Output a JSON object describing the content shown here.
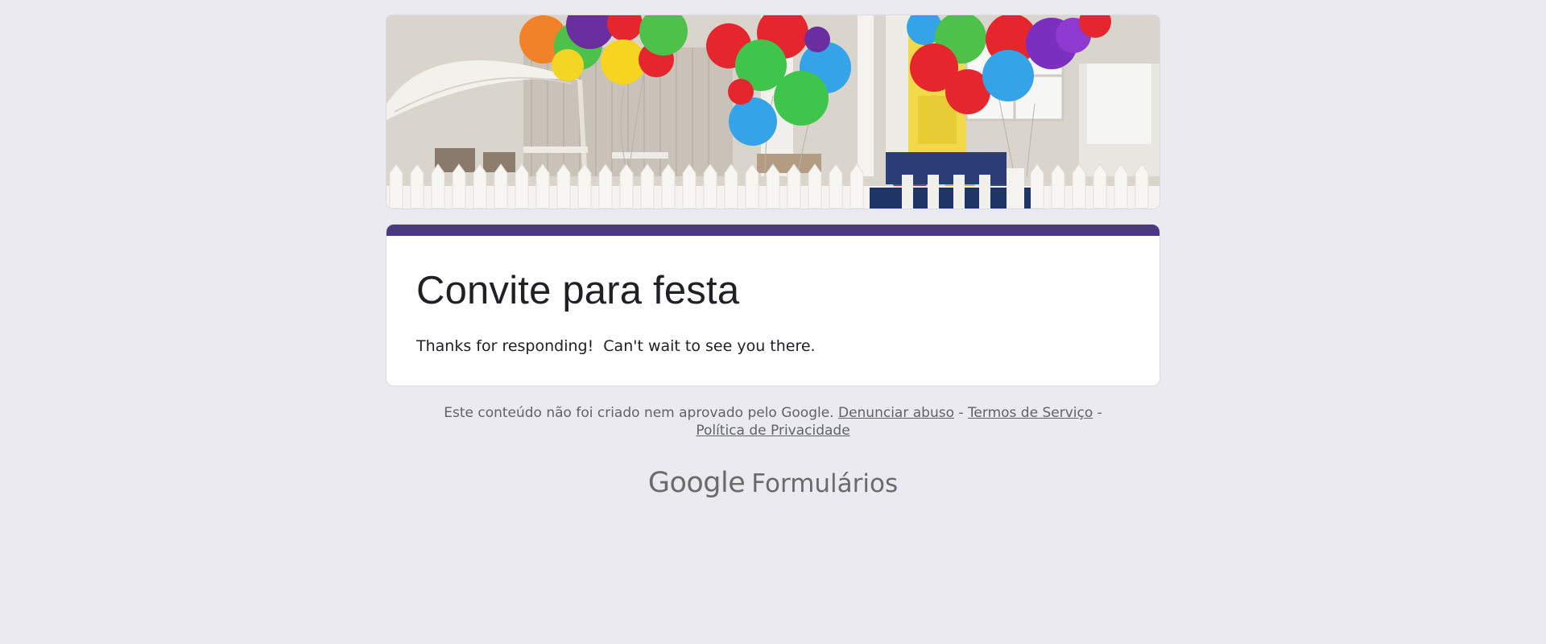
{
  "form": {
    "title": "Convite para festa",
    "confirmation_message": "Thanks for responding!  Can't wait to see you there.",
    "accent_color": "#4a3a7c"
  },
  "banner": {
    "image": "party-balloons-porch-header-image"
  },
  "footer": {
    "disclaimer": "Este conteúdo não foi criado nem aprovado pelo Google.",
    "report_abuse_link": "Denunciar abuso",
    "separator": " - ",
    "terms_link": "Termos de Serviço",
    "privacy_link": "Política de Privacidade"
  },
  "brand": {
    "google": "Google",
    "product": "Formulários"
  },
  "colors": {
    "background": "#ebeaf0",
    "card": "#ffffff",
    "text": "#202124",
    "muted_text": "#5f6368"
  }
}
